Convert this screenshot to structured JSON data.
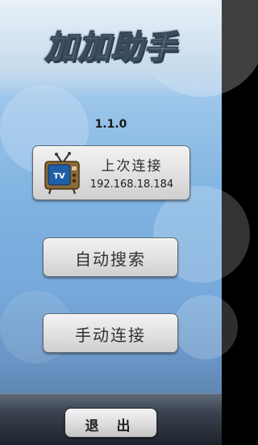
{
  "app": {
    "title": "加加助手",
    "version": "1.1.0"
  },
  "buttons": {
    "last_connection": {
      "label": "上次连接",
      "address": "192.168.18.184",
      "icon": "tv-icon",
      "icon_text": "TV"
    },
    "auto_search": {
      "label": "自动搜索"
    },
    "manual_connect": {
      "label": "手动连接"
    },
    "exit": {
      "label": "退 出"
    }
  },
  "colors": {
    "accent_blue": "#7fb3e1",
    "button_face": "#e2e2e2",
    "footer_dark": "#1e232b",
    "tv_screen": "#1f5fa8"
  }
}
